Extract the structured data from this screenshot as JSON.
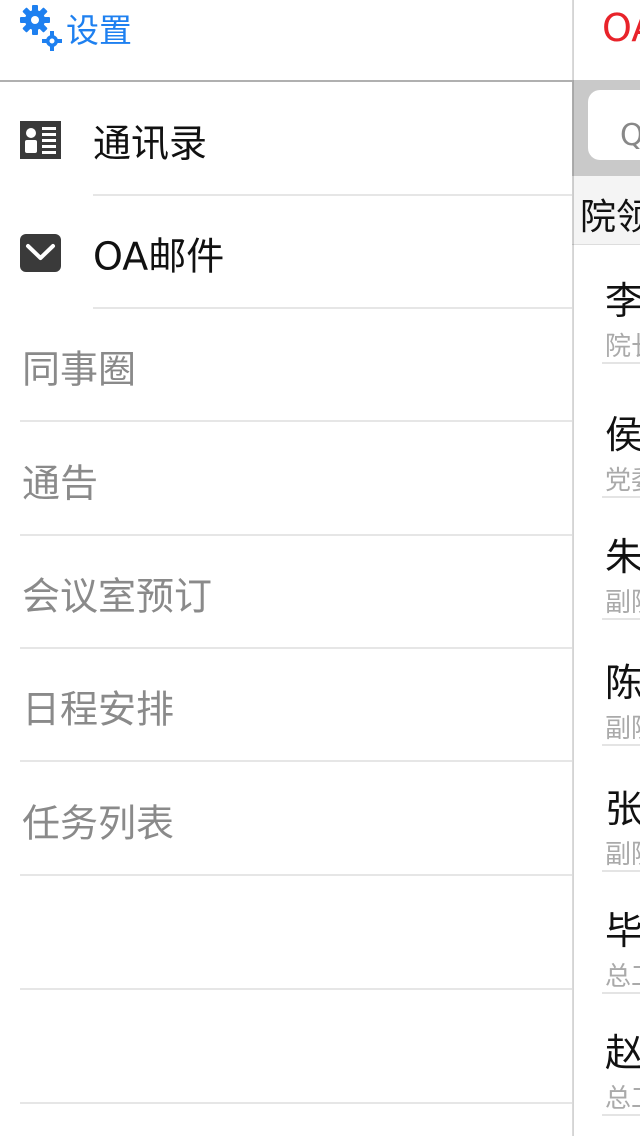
{
  "drawer": {
    "settings_label": "设置",
    "items": [
      {
        "label": "通讯录",
        "icon": "contacts-icon"
      },
      {
        "label": "OA邮件",
        "icon": "mail-icon"
      },
      {
        "label": "同事圈"
      },
      {
        "label": "通告"
      },
      {
        "label": "会议室预订"
      },
      {
        "label": "日程安排"
      },
      {
        "label": "任务列表"
      }
    ]
  },
  "panel": {
    "title": "OA",
    "search_glyph": "Q",
    "section_header": "院领",
    "contacts": [
      {
        "name": "李",
        "title": "院长"
      },
      {
        "name": "侯",
        "title": "党委"
      },
      {
        "name": "朱",
        "title": "副院"
      },
      {
        "name": "陈",
        "title": "副院"
      },
      {
        "name": "张",
        "title": "副院"
      },
      {
        "name": "毕",
        "title": "总工"
      },
      {
        "name": "赵",
        "title": "总工"
      }
    ]
  },
  "colors": {
    "accent_blue": "#1e80f0",
    "title_red": "#e8232a",
    "gray_text": "#8a8a8a",
    "divider": "#e6e6e6"
  }
}
